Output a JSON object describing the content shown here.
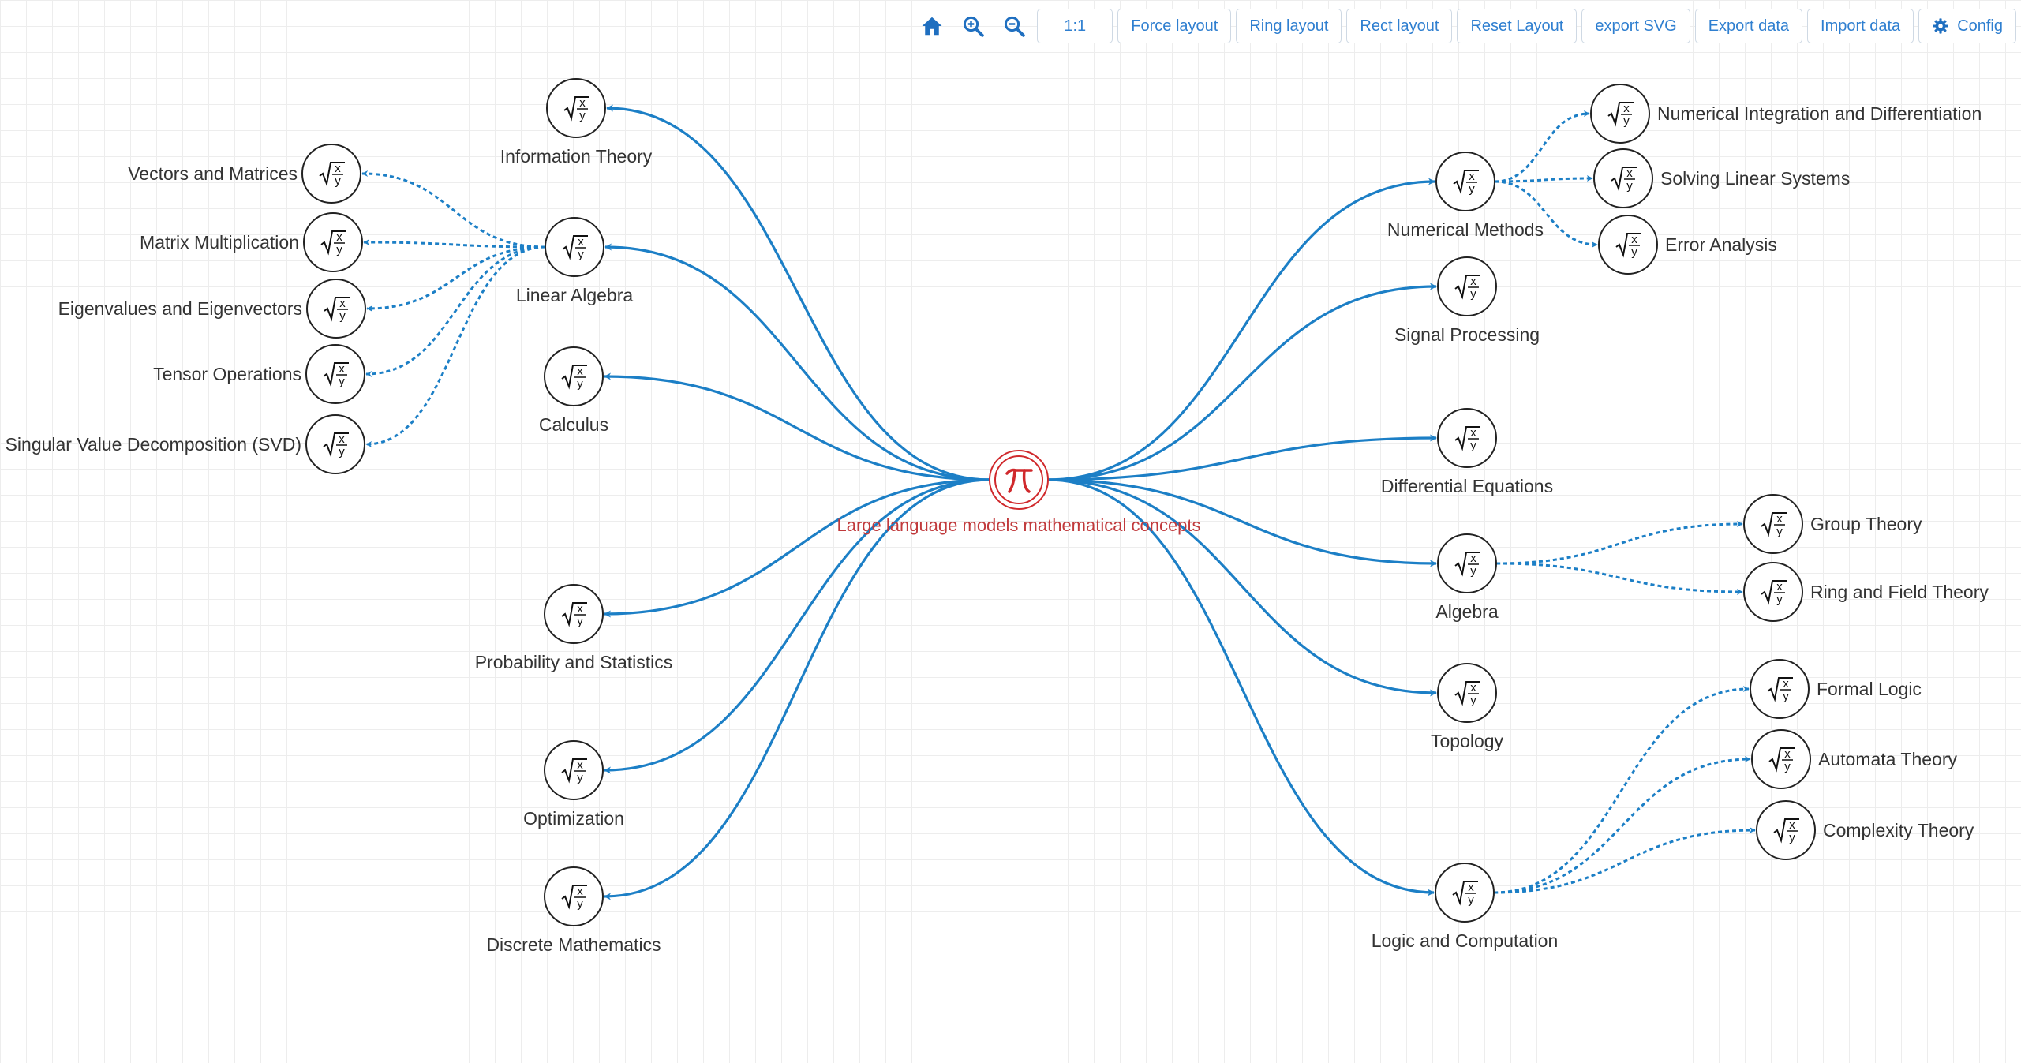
{
  "toolbar": {
    "home": "home-icon",
    "zoom_in": "zoom-in-icon",
    "zoom_out": "zoom-out-icon",
    "zoom_level": "1:1",
    "force_layout": "Force layout",
    "ring_layout": "Ring layout",
    "rect_layout": "Rect layout",
    "reset_layout": "Reset Layout",
    "export_svg": "export SVG",
    "export_data": "Export data",
    "import_data": "Import data",
    "config": "Config"
  },
  "colors": {
    "accent": "#1c7fc6",
    "root": "#d0292c",
    "root_label": "#c0393b",
    "node_border": "#222222",
    "button_text": "#2f7fd0"
  },
  "graph": {
    "root": {
      "label": "Large language models mathematical concepts",
      "icon": "pi-icon"
    },
    "branches": [
      {
        "id": "info",
        "label": "Information Theory",
        "side": "left",
        "children": []
      },
      {
        "id": "linalg",
        "label": "Linear Algebra",
        "side": "left",
        "children": [
          {
            "id": "vec",
            "label": "Vectors and Matrices"
          },
          {
            "id": "matmul",
            "label": "Matrix Multiplication"
          },
          {
            "id": "eig",
            "label": "Eigenvalues and Eigenvectors"
          },
          {
            "id": "tensor",
            "label": "Tensor Operations"
          },
          {
            "id": "svd",
            "label": "Singular Value Decomposition (SVD)"
          }
        ]
      },
      {
        "id": "calc",
        "label": "Calculus",
        "side": "left",
        "children": []
      },
      {
        "id": "prob",
        "label": "Probability and Statistics",
        "side": "left",
        "children": []
      },
      {
        "id": "opt",
        "label": "Optimization",
        "side": "left",
        "children": []
      },
      {
        "id": "disc",
        "label": "Discrete Mathematics",
        "side": "left",
        "children": []
      },
      {
        "id": "num",
        "label": "Numerical Methods",
        "side": "right",
        "children": [
          {
            "id": "nid",
            "label": "Numerical Integration and Differentiation"
          },
          {
            "id": "sls",
            "label": "Solving Linear Systems"
          },
          {
            "id": "err",
            "label": "Error Analysis"
          }
        ]
      },
      {
        "id": "sig",
        "label": "Signal Processing",
        "side": "right",
        "children": []
      },
      {
        "id": "diffeq",
        "label": "Differential Equations",
        "side": "right",
        "children": []
      },
      {
        "id": "alg",
        "label": "Algebra",
        "side": "right",
        "children": [
          {
            "id": "group",
            "label": "Group Theory"
          },
          {
            "id": "ring",
            "label": "Ring and Field Theory"
          }
        ]
      },
      {
        "id": "topo",
        "label": "Topology",
        "side": "right",
        "children": []
      },
      {
        "id": "logic",
        "label": "Logic and Computation",
        "side": "right",
        "children": [
          {
            "id": "formal",
            "label": "Formal Logic"
          },
          {
            "id": "automata",
            "label": "Automata Theory"
          },
          {
            "id": "complex",
            "label": "Complexity Theory"
          }
        ]
      }
    ]
  }
}
